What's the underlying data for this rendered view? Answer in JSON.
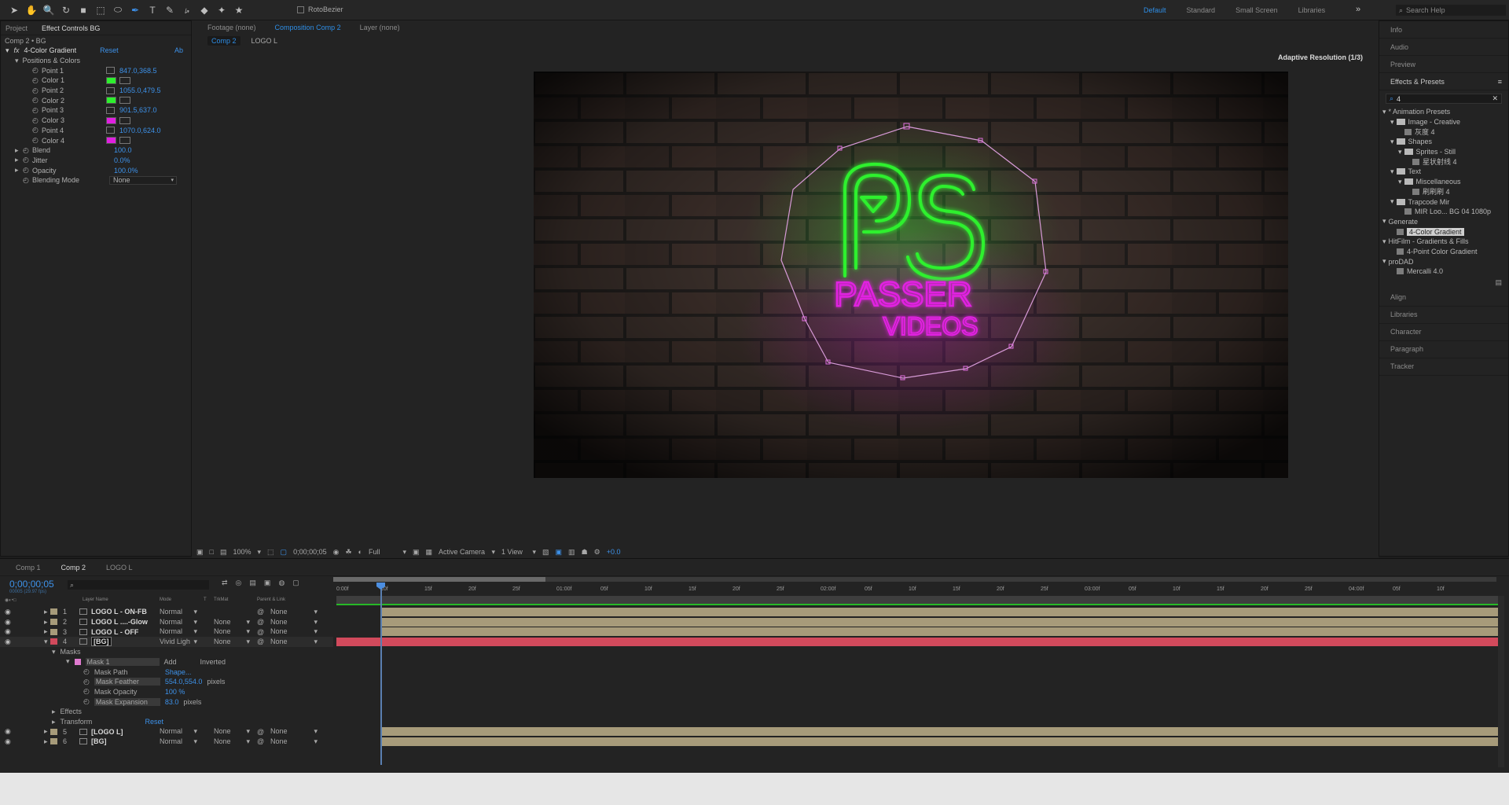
{
  "toolbar": {
    "roto_bezier_label": "RotoBezier",
    "workspaces": [
      "Default",
      "Standard",
      "Small Screen",
      "Libraries"
    ],
    "search_help_placeholder": "Search Help"
  },
  "left_panel": {
    "tabs": [
      "Project",
      "Effect Controls BG"
    ],
    "breadcrumb": "Comp 2 • BG",
    "effect_name": "4-Color Gradient",
    "reset_label": "Reset",
    "about_label": "Ab",
    "group_label": "Positions & Colors",
    "rows": [
      {
        "label": "Point 1",
        "value": "847.0,368.5",
        "kind": "point"
      },
      {
        "label": "Color 1",
        "value": "",
        "kind": "color",
        "color": "#2ef02e"
      },
      {
        "label": "Point 2",
        "value": "1055.0,479.5",
        "kind": "point"
      },
      {
        "label": "Color 2",
        "value": "",
        "kind": "color",
        "color": "#2ef02e"
      },
      {
        "label": "Point 3",
        "value": "901.5,637.0",
        "kind": "point"
      },
      {
        "label": "Color 3",
        "value": "",
        "kind": "color",
        "color": "#e020e0"
      },
      {
        "label": "Point 4",
        "value": "1070.0,624.0",
        "kind": "point"
      },
      {
        "label": "Color 4",
        "value": "",
        "kind": "color",
        "color": "#e020e0"
      }
    ],
    "blend": {
      "label": "Blend",
      "value": "100.0"
    },
    "jitter": {
      "label": "Jitter",
      "value": "0.0%"
    },
    "opacity": {
      "label": "Opacity",
      "value": "100.0%"
    },
    "blending_mode": {
      "label": "Blending Mode",
      "value": "None"
    }
  },
  "viewer": {
    "tabs": [
      "Footage (none)",
      "Composition Comp 2",
      "Layer (none)"
    ],
    "breadcrumbs": [
      "Comp 2",
      "LOGO L"
    ],
    "adaptive_resolution": "Adaptive Resolution (1/3)",
    "logo_title": "PASSER",
    "logo_subtitle": "VIDEOS",
    "zoom": "100%",
    "timecode": "0;00;00;05",
    "resolution": "Full",
    "camera": "Active Camera",
    "views": "1 View",
    "exposure": "+0.0",
    "colors": {
      "green": "#2ef02e",
      "magenta": "#e020e0"
    }
  },
  "right_panel": {
    "top_items": [
      "Info",
      "Audio",
      "Preview"
    ],
    "effects_presets_title": "Effects & Presets",
    "search_value": "4",
    "tree": [
      {
        "label": "* Animation Presets",
        "indent": 0,
        "kind": "root"
      },
      {
        "label": "Image - Creative",
        "indent": 1,
        "kind": "folder"
      },
      {
        "label": "灰度 4",
        "indent": 2,
        "kind": "file"
      },
      {
        "label": "Shapes",
        "indent": 1,
        "kind": "folder"
      },
      {
        "label": "Sprites - Still",
        "indent": 2,
        "kind": "folder"
      },
      {
        "label": "星状射线 4",
        "indent": 3,
        "kind": "file"
      },
      {
        "label": "Text",
        "indent": 1,
        "kind": "folder"
      },
      {
        "label": "Miscellaneous",
        "indent": 2,
        "kind": "folder"
      },
      {
        "label": "刷刷刷 4",
        "indent": 3,
        "kind": "file"
      },
      {
        "label": "Trapcode Mir",
        "indent": 1,
        "kind": "folder"
      },
      {
        "label": "MIR Loo... BG 04 1080p",
        "indent": 2,
        "kind": "file"
      },
      {
        "label": "Generate",
        "indent": 0,
        "kind": "root"
      },
      {
        "label": "4-Color Gradient",
        "indent": 1,
        "kind": "file",
        "selected": true
      },
      {
        "label": "HitFilm - Gradients & Fills",
        "indent": 0,
        "kind": "root"
      },
      {
        "label": "4-Point Color Gradient",
        "indent": 1,
        "kind": "file"
      },
      {
        "label": "proDAD",
        "indent": 0,
        "kind": "root"
      },
      {
        "label": "Mercalli 4.0",
        "indent": 1,
        "kind": "file"
      }
    ],
    "bottom_items": [
      "Align",
      "Libraries",
      "Character",
      "Paragraph",
      "Tracker"
    ]
  },
  "timeline": {
    "tabs": [
      "Comp 1",
      "Comp 2",
      "LOGO L"
    ],
    "timecode": "0;00;00;05",
    "fps_label": "00005 (29.97 fps)",
    "columns": {
      "layer_name": "Layer Name",
      "mode": "Mode",
      "t": "T",
      "trkmat": "TrkMat",
      "parent": "Parent & Link"
    },
    "ruler_labels": [
      "0:00f",
      "10f",
      "15f",
      "20f",
      "25f",
      "01:00f",
      "05f",
      "10f",
      "15f",
      "20f",
      "25f",
      "02:00f",
      "05f",
      "10f",
      "15f",
      "20f",
      "25f",
      "03:00f",
      "05f",
      "10f",
      "15f",
      "20f",
      "25f",
      "04:00f",
      "05f",
      "10f"
    ],
    "layers": [
      {
        "num": "1",
        "name": "LOGO L - ON-FB",
        "mode": "Normal",
        "trkmat": "",
        "parent": "None",
        "color": "#a79b7a"
      },
      {
        "num": "2",
        "name": "LOGO L ....-Glow",
        "mode": "Normal",
        "trkmat": "None",
        "parent": "None",
        "color": "#a79b7a"
      },
      {
        "num": "3",
        "name": "LOGO L - OFF",
        "mode": "Normal",
        "trkmat": "None",
        "parent": "None",
        "color": "#a79b7a"
      },
      {
        "num": "4",
        "name": "[BG]",
        "mode": "Vivid Ligh",
        "trkmat": "None",
        "parent": "None",
        "color": "#d24a5c"
      }
    ],
    "masks_label": "Masks",
    "mask": {
      "name": "Mask 1",
      "mode": "Add",
      "inverted": "Inverted"
    },
    "mask_props": [
      {
        "label": "Mask Path",
        "value": "Shape..."
      },
      {
        "label": "Mask Feather",
        "value": "554.0,554.0",
        "unit": "pixels"
      },
      {
        "label": "Mask Opacity",
        "value": "100 %"
      },
      {
        "label": "Mask Expansion",
        "value": "83.0",
        "unit": "pixels"
      }
    ],
    "effects_label": "Effects",
    "transform_label": "Transform",
    "transform_reset": "Reset",
    "layers_after": [
      {
        "num": "5",
        "name": "[LOGO L]",
        "mode": "Normal",
        "trkmat": "None",
        "parent": "None",
        "color": "#a79b7a"
      },
      {
        "num": "6",
        "name": "[BG]",
        "mode": "Normal",
        "trkmat": "None",
        "parent": "None",
        "color": "#a79b7a"
      }
    ]
  }
}
